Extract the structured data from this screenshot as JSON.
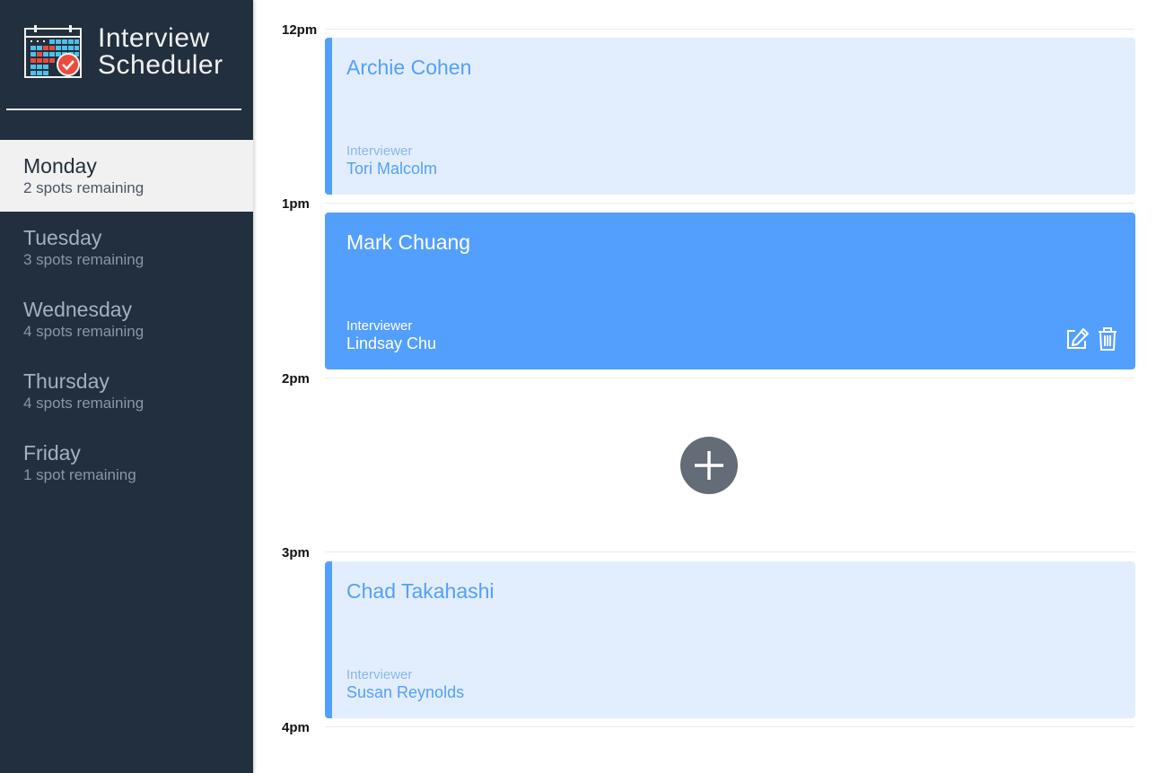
{
  "app": {
    "title_line1": "Interview",
    "title_line2": "Scheduler",
    "logo_icon": "calendar-check-icon"
  },
  "sidebar": {
    "days": [
      {
        "name": "Monday",
        "spots": "2 spots remaining",
        "selected": true
      },
      {
        "name": "Tuesday",
        "spots": "3 spots remaining",
        "selected": false
      },
      {
        "name": "Wednesday",
        "spots": "4 spots remaining",
        "selected": false
      },
      {
        "name": "Thursday",
        "spots": "4 spots remaining",
        "selected": false
      },
      {
        "name": "Friday",
        "spots": "1 spot remaining",
        "selected": false
      }
    ]
  },
  "schedule": {
    "hours": [
      "12pm",
      "1pm",
      "2pm",
      "3pm",
      "4pm"
    ],
    "appointments": [
      {
        "time": "12pm",
        "student": "Archie Cohen",
        "interviewer_label": "Interviewer",
        "interviewer": "Tori Malcolm",
        "focused": false
      },
      {
        "time": "1pm",
        "student": "Mark Chuang",
        "interviewer_label": "Interviewer",
        "interviewer": "Lindsay Chu",
        "focused": true,
        "actions": [
          "edit-icon",
          "trash-icon"
        ]
      },
      {
        "time": "2pm",
        "empty": true,
        "add_icon": "plus-icon"
      },
      {
        "time": "3pm",
        "student": "Chad Takahashi",
        "interviewer_label": "Interviewer",
        "interviewer": "Susan Reynolds",
        "focused": false
      }
    ]
  },
  "colors": {
    "sidebar_bg": "#222f3e",
    "accent": "#539ffd",
    "appointment_bg": "#e2eefd",
    "add_button": "#636c77"
  }
}
